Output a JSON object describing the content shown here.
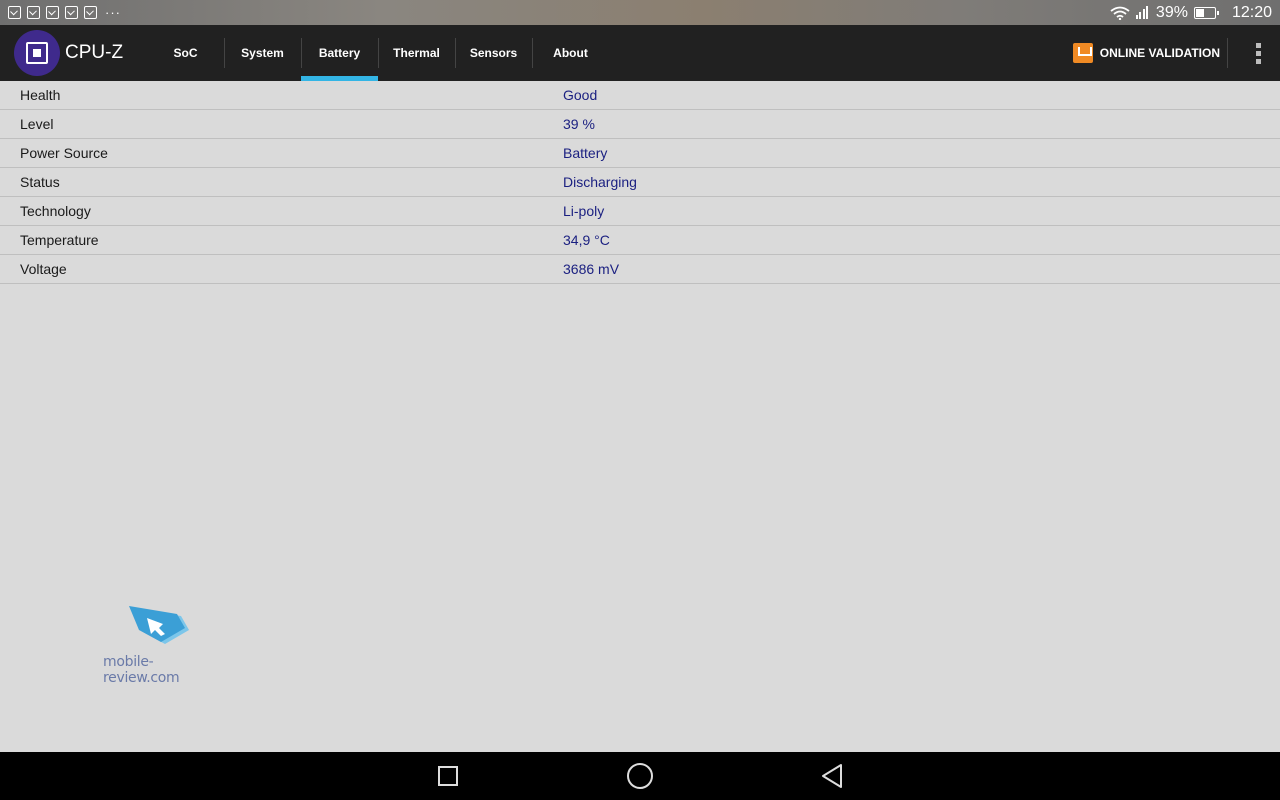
{
  "status_bar": {
    "notification_icons": [
      "image-icon",
      "x-app-icon",
      "check-bag-icon",
      "check-bag-icon",
      "check-bag-icon"
    ],
    "more_indicator": "···",
    "battery_percent": "39%",
    "battery_level": 0.39,
    "time": "12:20"
  },
  "app_bar": {
    "title": "CPU-Z",
    "tabs": [
      {
        "label": "SoC",
        "active": false
      },
      {
        "label": "System",
        "active": false
      },
      {
        "label": "Battery",
        "active": true
      },
      {
        "label": "Thermal",
        "active": false
      },
      {
        "label": "Sensors",
        "active": false
      },
      {
        "label": "About",
        "active": false
      }
    ],
    "validation_label": "ONLINE VALIDATION",
    "accent_color": "#33b5e5",
    "validation_color": "#f08a24"
  },
  "battery_info": [
    {
      "label": "Health",
      "value": "Good"
    },
    {
      "label": "Level",
      "value": "39 %"
    },
    {
      "label": "Power Source",
      "value": "Battery"
    },
    {
      "label": "Status",
      "value": "Discharging"
    },
    {
      "label": "Technology",
      "value": "Li-poly"
    },
    {
      "label": "Temperature",
      "value": "34,9 °C"
    },
    {
      "label": "Voltage",
      "value": "3686 mV"
    }
  ],
  "watermark": {
    "text": "mobile-review.com"
  },
  "nav_bar": {
    "buttons": [
      "recents-icon",
      "home-icon",
      "back-icon"
    ]
  }
}
